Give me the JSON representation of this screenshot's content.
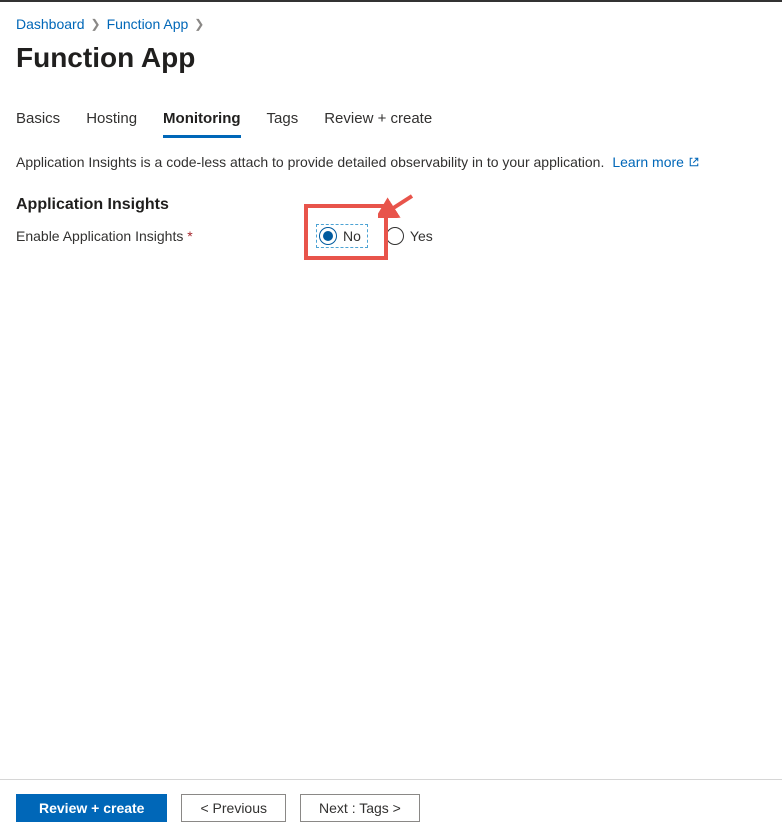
{
  "breadcrumb": {
    "items": [
      {
        "label": "Dashboard"
      },
      {
        "label": "Function App"
      }
    ]
  },
  "page": {
    "title": "Function App"
  },
  "tabs": [
    {
      "label": "Basics",
      "active": false
    },
    {
      "label": "Hosting",
      "active": false
    },
    {
      "label": "Monitoring",
      "active": true
    },
    {
      "label": "Tags",
      "active": false
    },
    {
      "label": "Review + create",
      "active": false
    }
  ],
  "monitoring": {
    "description": "Application Insights is a code-less attach to provide detailed observability in to your application.",
    "learn_more": "Learn more",
    "section_heading": "Application Insights",
    "field_label": "Enable Application Insights",
    "options": {
      "no": "No",
      "yes": "Yes"
    },
    "selected": "No"
  },
  "footer": {
    "review_create": "Review + create",
    "previous": "< Previous",
    "next": "Next : Tags >"
  }
}
